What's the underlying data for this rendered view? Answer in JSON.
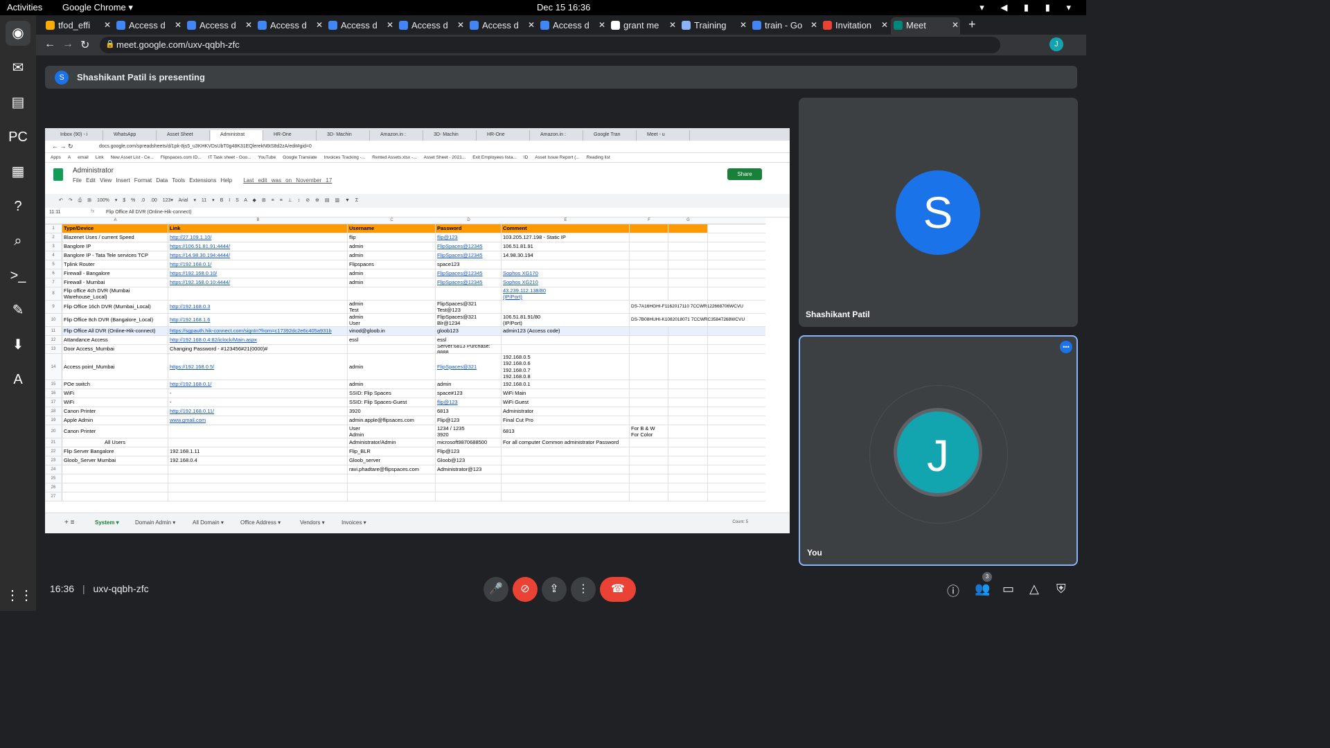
{
  "topbar": {
    "activities": "Activities",
    "app": "Google Chrome ▾",
    "clock": "Dec 15  16:36",
    "tray": "▾ ◀ ▮ ▮ ▾"
  },
  "dock": [
    {
      "icon": "chrome-icon",
      "glyph": "◉"
    },
    {
      "icon": "thunderbird-icon",
      "glyph": "✉"
    },
    {
      "icon": "files-icon",
      "glyph": "▤"
    },
    {
      "icon": "pycharm-icon",
      "glyph": "PC"
    },
    {
      "icon": "writer-icon",
      "glyph": "▦"
    },
    {
      "icon": "help-icon",
      "glyph": "?"
    },
    {
      "icon": "search-icon",
      "glyph": "⌕"
    },
    {
      "icon": "terminal-icon",
      "glyph": ">_"
    },
    {
      "icon": "editor-icon",
      "glyph": "✎"
    },
    {
      "icon": "installer-icon",
      "glyph": "⬇"
    },
    {
      "icon": "software-icon",
      "glyph": "A"
    },
    {
      "icon": "apps-grid-icon",
      "glyph": "⋮⋮⋮"
    }
  ],
  "tabs": [
    {
      "label": "tfod_effi",
      "color": "#f9ab00"
    },
    {
      "label": "Access d",
      "color": "#4285f4"
    },
    {
      "label": "Access d",
      "color": "#4285f4"
    },
    {
      "label": "Access d",
      "color": "#4285f4"
    },
    {
      "label": "Access d",
      "color": "#4285f4"
    },
    {
      "label": "Access d",
      "color": "#4285f4"
    },
    {
      "label": "Access d",
      "color": "#4285f4"
    },
    {
      "label": "Access d",
      "color": "#4285f4"
    },
    {
      "label": "grant me",
      "color": "#ffffff"
    },
    {
      "label": "Training",
      "color": "#8ab4f8"
    },
    {
      "label": "train - Go",
      "color": "#4285f4"
    },
    {
      "label": "Invitation",
      "color": "#ea4335"
    },
    {
      "label": "Meet",
      "color": "#00897b"
    }
  ],
  "address": {
    "url": "meet.google.com/uxv-qqbh-zfc",
    "profile": "J"
  },
  "presenting": {
    "avatar": "S",
    "text": "Shashikant Patil is presenting"
  },
  "inner": {
    "tabs": [
      "Inbox (90) - i",
      "WhatsApp",
      "Asset Sheet",
      "Administrat",
      "HR-One",
      "3D- Machin",
      "Amazon.in : ",
      "3D- Machin",
      "HR-One",
      "Amazon.in : ",
      "Google Tran",
      "Meet - u"
    ],
    "url": "docs.google.com/spreadsheets/d/1pk-8js5_u3KHKVDsUbT0g48K31EQlerekN6tS8d2zA/edit#gid=0",
    "bookmarks": [
      "Apps",
      "A",
      "email",
      "Link",
      "New Asset List - Ce...",
      "Flipspaces.com ID...",
      "IT Task sheet - Goo...",
      "YouTube",
      "Google Translate",
      "Invoices Tracking -...",
      "Rented Assets.xlsx -...",
      "Asset Sheet - 2021...",
      "Exit Employees lista...",
      "ID",
      "Asset Issue Report (...",
      "Reading list"
    ],
    "doc_title": "Administrator",
    "menu": "File Edit View Insert Format Data Tools Extensions Help",
    "last_edit": "Last edit was on November 17",
    "share": "Share",
    "toolbar": "↶ ↷ ⎙ ⊞ 100% ▾ $ % .0 .00 123▾ Arial ▾ 11 ▾ B I S A ◆ ⊞ ≡ ≡ ⊥ ↕ ⊘ ⊕ ▤ ▥ ▼ Σ",
    "cell_ref": "11:11",
    "formula": "Flip Office All DVR (Online-Hik-connect)",
    "columns": [
      "A",
      "B",
      "C",
      "D",
      "E",
      "F",
      "G"
    ],
    "rows": [
      {
        "n": "1",
        "cells": [
          "Type/Device",
          "Link",
          "Username",
          "Password",
          "Comment",
          "",
          ""
        ],
        "header": true
      },
      {
        "n": "2",
        "cells": [
          "Blazenet Uses / current Speed",
          "http://27.109.1.10/",
          "flip",
          "flip@123",
          "103.205.127.198 - Static IP",
          "",
          ""
        ]
      },
      {
        "n": "3",
        "cells": [
          "Banglore IP",
          "https://106.51.81.91:4444/",
          "admin",
          "FlipSpaces@12345",
          "106.51.81.91",
          "",
          ""
        ]
      },
      {
        "n": "4",
        "cells": [
          "Banglore IP -  Tata Tele services TCP",
          "https://14.98.30.194:4444/",
          "admin",
          "FlipSpaces@12345",
          "14.98.30.194",
          "",
          ""
        ]
      },
      {
        "n": "5",
        "cells": [
          "Tplink Router",
          "http://192.168.0.1/",
          "Flipspaces",
          "space123",
          "",
          "",
          ""
        ]
      },
      {
        "n": "6",
        "cells": [
          "Firewall - Bangalore",
          "https://192.168.0.10/",
          "admin",
          "FlipSpaces@12345",
          "Sophos XG170",
          "",
          ""
        ]
      },
      {
        "n": "7",
        "cells": [
          "Firewall - Mumbai",
          "https://192.168.0.10:4444/",
          "admin",
          "FlipSpaces@12345",
          "Sophos XG210",
          "",
          ""
        ]
      },
      {
        "n": "8",
        "cells": [
          "Flip office 4ch DVR (Mumbai\nWarehouse_Local)",
          "",
          "",
          "",
          "43.239.112.138/80\n(IP/Port)",
          "",
          ""
        ]
      },
      {
        "n": "9",
        "cells": [
          "Flip Office 16ch DVR (Mumbai_Local)",
          "http://192.168.0.3",
          "admin\nTest",
          "FlipSpaces@321\nTest@123",
          "",
          "DS-7A16HGHI-F1162017110 7CCWR122668706WCVU",
          ""
        ]
      },
      {
        "n": "10",
        "cells": [
          "Flip Office 8ch DVR (Bangalore_Local)",
          "http://192.168.1.6",
          "admin\nUser",
          "FlipSpaces@321\nBlr@1234",
          "106.51.81.91/80\n(IP/Port)",
          "DS-7B08HUHI-K1082018071 7CCWRC35847268WCVU",
          ""
        ]
      },
      {
        "n": "11",
        "cells": [
          "Flip Office All DVR (Online-Hik-connect)",
          "https://sgpauth.hik-connect.com/signIn?from=c17392dc2e6c405a931b",
          "vinod@gloob.in",
          "gloob123",
          "admin123 (Access code)",
          "",
          ""
        ],
        "selected": true
      },
      {
        "n": "12",
        "cells": [
          "Attandance Access",
          "http://192.168.0.4:82/iclock/Main.aspx",
          "essl",
          "essl",
          "",
          "",
          ""
        ]
      },
      {
        "n": "13",
        "cells": [
          "Door Access_Mumbai",
          "Changing Password - #123456#21(0000)#",
          "",
          "Server:6813 Purchase: 8888",
          "",
          "",
          ""
        ]
      },
      {
        "n": "14",
        "cells": [
          "Access point_Mumbai",
          "https://192.168.0.5/",
          "admin",
          "FlipSpaces@321",
          "192.168.0.5\n192.168.0.6\n192.168.0.7\n192.168.0.8",
          "",
          ""
        ]
      },
      {
        "n": "15",
        "cells": [
          "POe switch",
          "http://192.168.0.1/",
          "admin",
          "admin",
          "192.168.0.1",
          "",
          ""
        ]
      },
      {
        "n": "16",
        "cells": [
          "WiFi",
          "-",
          "SSID: Flip Spaces",
          "space#123",
          "WiFi Main",
          "",
          ""
        ]
      },
      {
        "n": "17",
        "cells": [
          "WiFi",
          "-",
          "SSID: Flip Spaces-Guest",
          "flip@123",
          "WiFi Guest",
          "",
          ""
        ]
      },
      {
        "n": "18",
        "cells": [
          "Canon Printer",
          "http://192.168.0.11/",
          "3920",
          "6813",
          "Administrator",
          "",
          ""
        ]
      },
      {
        "n": "19",
        "cells": [
          "Apple Admin",
          "www.gmail.com",
          "admin.apple@flipsaces.com",
          "Flip@123",
          "Final Cut Pro",
          "",
          ""
        ]
      },
      {
        "n": "20",
        "cells": [
          "Canon Printer",
          "",
          "User\nAdmin",
          "1234 / 1235\n3920",
          "6813",
          "For B & W\nFor Color",
          ""
        ]
      },
      {
        "n": "21",
        "cells": [
          "All Users",
          "",
          "Administrator/Admin",
          "microsoft9870688500",
          "For all computer Common administrator Password",
          "",
          ""
        ]
      },
      {
        "n": "22",
        "cells": [
          "Flip Server Bangalore",
          "192.168.1.11",
          "Flip_BLR",
          "Flip@123",
          "",
          "",
          ""
        ]
      },
      {
        "n": "23",
        "cells": [
          "Gloob_Server Mumbai",
          "192.168.0.4",
          "Gloob_server",
          "Gloob@123",
          "",
          "",
          ""
        ]
      },
      {
        "n": "24",
        "cells": [
          "",
          "",
          "ravi.phadtare@flipspaces.com",
          "Administrator@123",
          "",
          "",
          ""
        ]
      },
      {
        "n": "25",
        "cells": [
          "",
          "",
          "",
          "",
          "",
          "",
          ""
        ]
      },
      {
        "n": "26",
        "cells": [
          "",
          "",
          "",
          "",
          "",
          "",
          ""
        ]
      },
      {
        "n": "27",
        "cells": [
          "",
          "",
          "",
          "",
          "",
          "",
          ""
        ]
      }
    ],
    "sheets": [
      "System ▾",
      "Domain Admin ▾",
      "All Domain ▾",
      "Office Address ▾",
      "Vendors ▾",
      "Invoices ▾"
    ],
    "count": "Count: 5"
  },
  "participants": [
    {
      "initial": "S",
      "name": "Shashikant Patil",
      "color": "#1a73e8"
    },
    {
      "initial": "J",
      "name": "You",
      "color": "#12a4af"
    }
  ],
  "bottom": {
    "time": "16:36",
    "code": "uxv-qqbh-zfc",
    "people_count": "3"
  }
}
